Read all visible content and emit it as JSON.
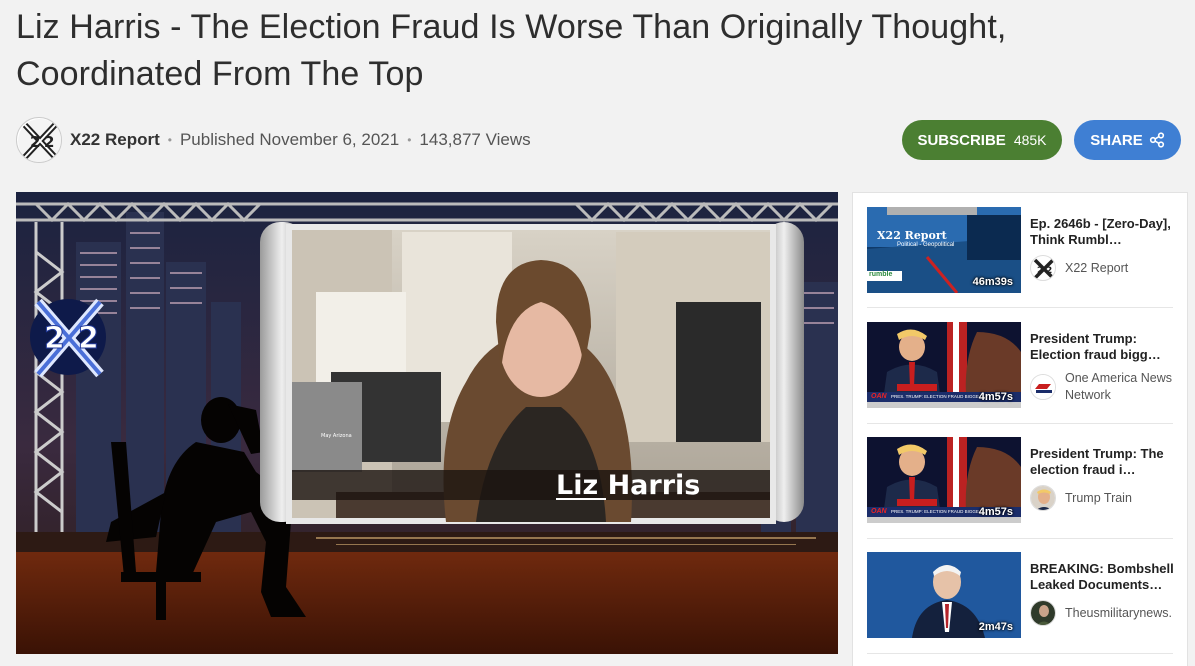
{
  "video": {
    "title_line1": "Liz Harris - The Election Fraud Is Worse Than Originally Thought,",
    "title_line2": "Coordinated From The Top",
    "channel": "X22 Report",
    "published": "Published November 6, 2021",
    "views": "143,877 Views",
    "lower_third_name": "Liz Harris",
    "logo_text": "2X2",
    "bg_caption": "May Arizona be the First Domino to Fall"
  },
  "actions": {
    "subscribe_label": "SUBSCRIBE",
    "subscribe_count": "485K",
    "share_label": "SHARE"
  },
  "recommendations": [
    {
      "title": "Ep. 2646b - [Zero-Day], Think Rumbl…",
      "channel": "X22 Report",
      "duration": "46m39s",
      "thumb_text": "X22 Report",
      "thumb_sub": "Political - Geopolitical",
      "thumb_brand": "rumble"
    },
    {
      "title": "President Trump: Election fraud bigg…",
      "channel": "One America News Network",
      "duration": "4m57s",
      "thumb_ticker": "PRES. TRUMP: ELECTION FRAUD BIGGE",
      "thumb_brand": "OAN"
    },
    {
      "title": "President Trump: The election fraud i…",
      "channel": "Trump Train",
      "duration": "4m57s",
      "thumb_ticker": "PRES. TRUMP: ELECTION FRAUD BIGGE",
      "thumb_brand": "OAN"
    },
    {
      "title": "BREAKING: Bombshell Leaked Documents…",
      "channel": "Theusmilitarynews.",
      "duration": "2m47s"
    }
  ],
  "colors": {
    "subscribe": "#4b7f32",
    "share": "#3f7fd3",
    "background": "#f2f2f2"
  },
  "icons": [
    "share-icon",
    "x22-logo",
    "oan-logo"
  ]
}
